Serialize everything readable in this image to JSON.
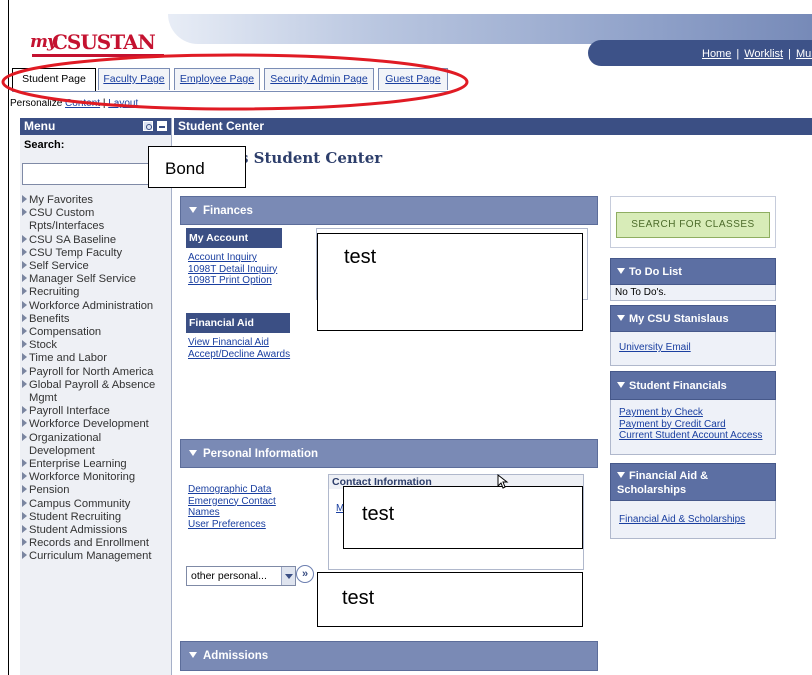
{
  "logo": {
    "prefix": "my",
    "name": "CSUSTAN"
  },
  "top_nav": {
    "links": [
      "Home",
      "Worklist",
      "Mul"
    ]
  },
  "tabs": [
    {
      "label": "Student Page",
      "active": true
    },
    {
      "label": "Faculty Page",
      "active": false
    },
    {
      "label": "Employee Page",
      "active": false
    },
    {
      "label": "Security Admin Page",
      "active": false
    },
    {
      "label": "Guest Page",
      "active": false
    }
  ],
  "personalize": {
    "prefix": "Personalize ",
    "content_link": "Content",
    "sep": " | ",
    "layout_link": "Layout"
  },
  "menu": {
    "title": "Menu",
    "search_label": "Search:",
    "search_value": "",
    "items": [
      "My Favorites",
      "CSU Custom Rpts/Interfaces",
      "CSU SA Baseline",
      "CSU Temp Faculty",
      "Self Service",
      "Manager Self Service",
      "Recruiting",
      "Workforce Administration",
      "Benefits",
      "Compensation",
      "Stock",
      "Time and Labor",
      "Payroll for North America",
      "Global Payroll & Absence Mgmt",
      "Payroll Interface",
      "Workforce Development",
      "Organizational Development",
      "Enterprise Learning",
      "Workforce Monitoring",
      "Pension",
      "Campus Community",
      "Student Recruiting",
      "Student Admissions",
      "Records and Enrollment",
      "Curriculum Management"
    ]
  },
  "main": {
    "header": "Student Center",
    "page_title": "s Student Center",
    "annotation_name": "Bond",
    "annotation_test": "test",
    "finances": {
      "label": "Finances",
      "my_account": {
        "label": "My Account",
        "links": [
          "Account Inquiry",
          "1098T Detail Inquiry",
          "1098T Print Option"
        ]
      },
      "financial_aid": {
        "label": "Financial Aid",
        "links": [
          "View Financial Aid",
          "Accept/Decline Awards"
        ]
      }
    },
    "personal": {
      "label": "Personal Information",
      "links": [
        "Demographic Data",
        "Emergency Contact",
        "Names",
        "User Preferences"
      ],
      "contact_title": "Contact Information",
      "contact_link_fragment": "M",
      "select_value": "other personal...",
      "go_label": "»"
    },
    "admissions": {
      "label": "Admissions"
    }
  },
  "right": {
    "search_classes": "SEARCH FOR CLASSES",
    "todo": {
      "label": "To Do List",
      "body": "No To Do's."
    },
    "mycsu": {
      "label": "My CSU Stanislaus",
      "links": [
        "University Email"
      ]
    },
    "student_financials": {
      "label": "Student Financials",
      "links": [
        "Payment by Check",
        "Payment by Credit Card",
        "Current Student Account Access"
      ]
    },
    "financial_aid": {
      "label": "Financial Aid & Scholarships",
      "links": [
        "Financial Aid & Scholarships"
      ]
    }
  },
  "colors": {
    "brand_red": "#c41230",
    "header_navy": "#3b4f84",
    "section_blue": "#7a8ab5",
    "annotation_red": "#e01b24"
  }
}
